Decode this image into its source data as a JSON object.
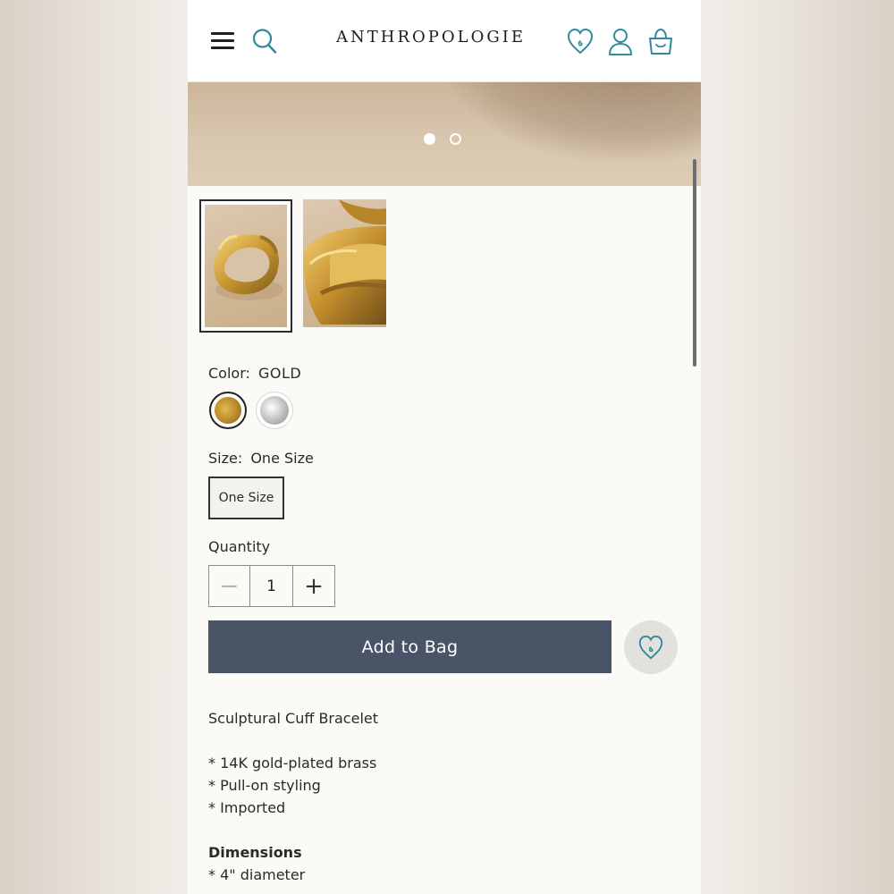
{
  "header": {
    "logo_text": "ANTHROPOLOGIE",
    "menu_icon": "hamburger-menu-icon",
    "search_icon": "search-icon",
    "wishlist_icon": "heart-icon",
    "account_icon": "user-icon",
    "bag_icon": "shopping-bag-icon",
    "accent_color": "#2f8a9c"
  },
  "gallery": {
    "slide_count": 2,
    "active_slide": 1,
    "thumbnails": [
      {
        "selected": true
      },
      {
        "selected": false
      }
    ]
  },
  "product": {
    "color_label": "Color:",
    "color_value": "GOLD",
    "swatches": [
      {
        "name": "gold",
        "selected": true
      },
      {
        "name": "silver",
        "selected": false
      }
    ],
    "size_label": "Size:",
    "size_value": "One Size",
    "size_options": [
      "One Size"
    ],
    "quantity_label": "Quantity",
    "quantity_value": "1",
    "quantity_minus": "−",
    "quantity_plus": "+",
    "add_to_bag_label": "Add to Bag",
    "add_to_bag_color": "#495567"
  },
  "description": {
    "title": "Sculptural Cuff Bracelet",
    "bullets": [
      "* 14K gold-plated brass",
      "* Pull-on styling",
      "* Imported"
    ],
    "dimensions_heading": "Dimensions",
    "dimensions_bullets": [
      "* 4\" diameter"
    ]
  }
}
